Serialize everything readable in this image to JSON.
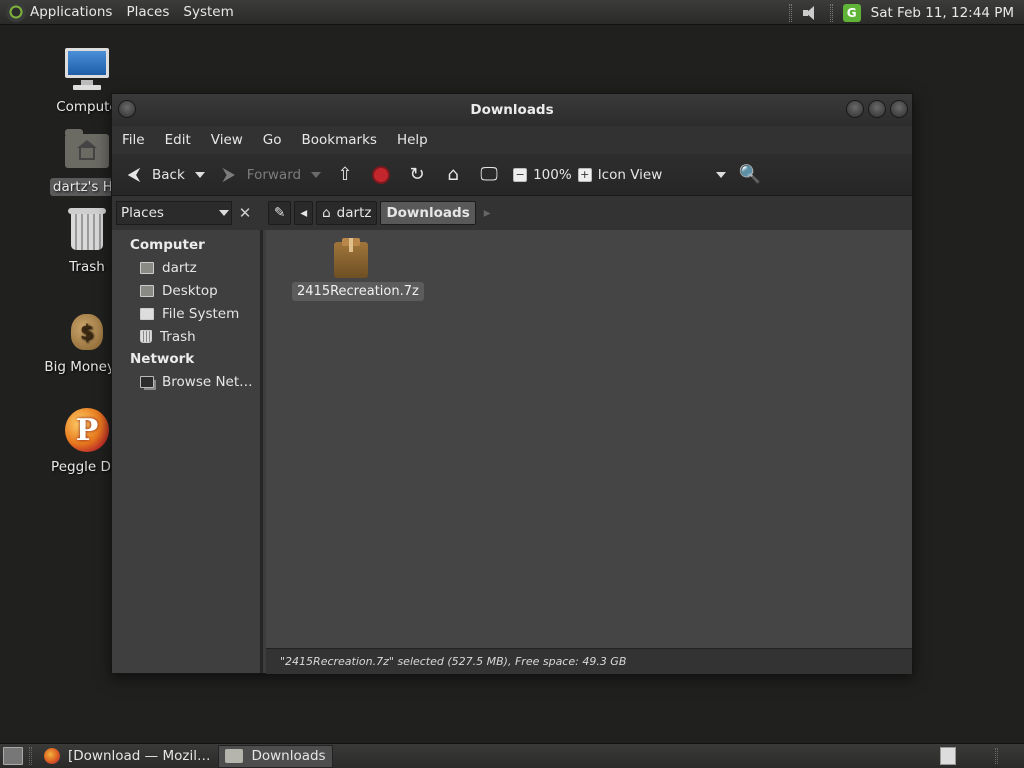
{
  "top_panel": {
    "menus": [
      "Applications",
      "Places",
      "System"
    ],
    "clock": "Sat Feb 11, 12:44 PM",
    "updater_label": "G"
  },
  "desktop": {
    "icons": [
      {
        "label": "Compute",
        "icon": "computer-icon"
      },
      {
        "label": "dartz's Ho",
        "icon": "home-folder-icon"
      },
      {
        "label": "Trash",
        "icon": "trash-icon"
      },
      {
        "label": "Big Money D",
        "icon": "money-bag-icon"
      },
      {
        "label": "Peggle Del",
        "icon": "peggle-icon"
      }
    ]
  },
  "window": {
    "title": "Downloads",
    "menu": [
      "File",
      "Edit",
      "View",
      "Go",
      "Bookmarks",
      "Help"
    ],
    "toolbar": {
      "back": "Back",
      "forward": "Forward",
      "zoom": "100%",
      "view_mode": "Icon View"
    },
    "location": {
      "places_label": "Places",
      "path": [
        "dartz",
        "Downloads"
      ]
    },
    "sidebar": {
      "sections": [
        {
          "heading": "Computer",
          "items": [
            {
              "label": "dartz",
              "icon": "home-icon"
            },
            {
              "label": "Desktop",
              "icon": "desktop-icon"
            },
            {
              "label": "File System",
              "icon": "filesystem-icon"
            },
            {
              "label": "Trash",
              "icon": "trash-icon"
            }
          ]
        },
        {
          "heading": "Network",
          "items": [
            {
              "label": "Browse Net…",
              "icon": "network-icon"
            }
          ]
        }
      ]
    },
    "files": [
      {
        "name": "2415Recreation.7z",
        "icon": "archive-icon",
        "selected": true
      }
    ],
    "status": "\"2415Recreation.7z\" selected (527.5 MB), Free space: 49.3 GB"
  },
  "bottom_panel": {
    "tasks": [
      {
        "label": "[Download — Mozil…",
        "icon": "firefox-icon",
        "active": false
      },
      {
        "label": "Downloads",
        "icon": "folder-icon",
        "active": true
      }
    ]
  },
  "colors": {
    "desktop_bg": "#20211f",
    "panel_bg": "#2f302e",
    "window_bg": "#3d3d3d",
    "content_bg": "#454545",
    "accent_green": "#5fb336",
    "stop_red": "#c4262e"
  }
}
